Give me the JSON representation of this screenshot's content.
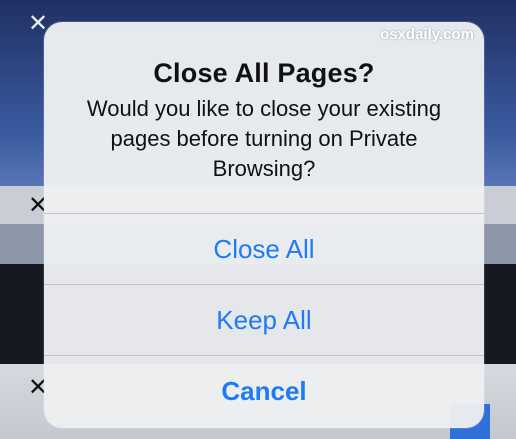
{
  "background": {
    "tab_close_glyph": "✕"
  },
  "alert": {
    "title": "Close All Pages?",
    "message": "Would you like to close your existing pages before turning on Private Browsing?",
    "buttons": {
      "close_all": "Close All",
      "keep_all": "Keep All",
      "cancel": "Cancel"
    }
  },
  "watermark": "osxdaily.com",
  "colors": {
    "button_blue": "#1e7af5",
    "alert_background": "#eceef1"
  },
  "icons": [
    "close-icon"
  ]
}
